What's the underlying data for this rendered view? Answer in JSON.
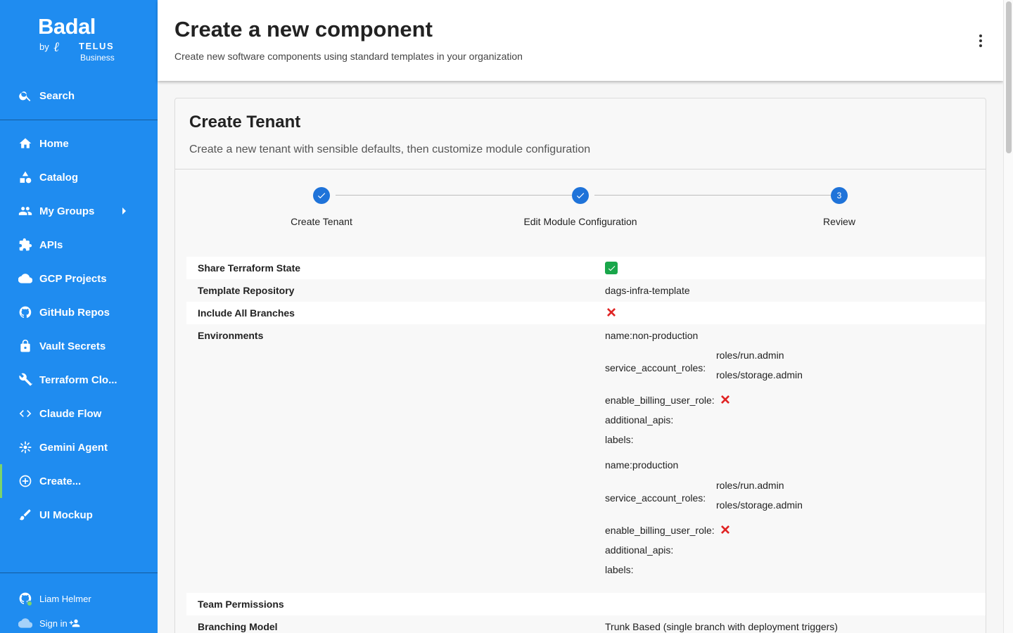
{
  "sidebar": {
    "logo": {
      "brand": "Badal",
      "by": "by",
      "telus": "TELUS",
      "business": "Business"
    },
    "search_label": "Search",
    "items": [
      {
        "label": "Home",
        "icon": "home-icon"
      },
      {
        "label": "Catalog",
        "icon": "catalog-icon"
      },
      {
        "label": "My Groups",
        "icon": "groups-icon"
      },
      {
        "label": "APIs",
        "icon": "puzzle-icon"
      },
      {
        "label": "GCP Projects",
        "icon": "cloud-icon"
      },
      {
        "label": "GitHub Repos",
        "icon": "github-icon"
      },
      {
        "label": "Vault Secrets",
        "icon": "lock-icon"
      },
      {
        "label": "Terraform Clo...",
        "icon": "wrench-icon"
      },
      {
        "label": "Claude Flow",
        "icon": "code-icon"
      },
      {
        "label": "Gemini Agent",
        "icon": "sparkle-icon"
      },
      {
        "label": "Create...",
        "icon": "add-circle-icon",
        "active": true
      },
      {
        "label": "UI Mockup",
        "icon": "brush-icon"
      }
    ],
    "user_name": "Liam Helmer",
    "sign_in_label": "Sign in",
    "colors": {
      "background": "#1f8cf0",
      "active_indicator": "#7cd46a"
    }
  },
  "header": {
    "title": "Create a new component",
    "subtitle": "Create new software components using standard templates in your organization"
  },
  "card": {
    "title": "Create Tenant",
    "subtitle": "Create a new tenant with sensible defaults, then customize module configuration",
    "steps": [
      {
        "label": "Create Tenant",
        "state": "done"
      },
      {
        "label": "Edit Module Configuration",
        "state": "done"
      },
      {
        "label": "Review",
        "state": "current",
        "number": "3"
      }
    ],
    "review": {
      "share_state_label": "Share Terraform State",
      "share_state_value": true,
      "template_repo_label": "Template Repository",
      "template_repo_value": "dags-infra-template",
      "include_branches_label": "Include All Branches",
      "include_branches_value": false,
      "environments_label": "Environments",
      "environments": [
        {
          "name": "name:non-production",
          "sa_roles_label": "service_account_roles:",
          "sa_roles": [
            "roles/run.admin",
            "roles/storage.admin"
          ],
          "billing_label": "enable_billing_user_role:",
          "billing_value": false,
          "apis_label": "additional_apis:",
          "labels_label": "labels:"
        },
        {
          "name": "name:production",
          "sa_roles_label": "service_account_roles:",
          "sa_roles": [
            "roles/run.admin",
            "roles/storage.admin"
          ],
          "billing_label": "enable_billing_user_role:",
          "billing_value": false,
          "apis_label": "additional_apis:",
          "labels_label": "labels:"
        }
      ],
      "team_permissions_label": "Team Permissions",
      "branching_model_label": "Branching Model",
      "branching_model_value": "Trunk Based (single branch with deployment triggers)"
    },
    "colors": {
      "step": "#1f73d9",
      "check": "#19a64a",
      "cross": "#e02424"
    }
  }
}
